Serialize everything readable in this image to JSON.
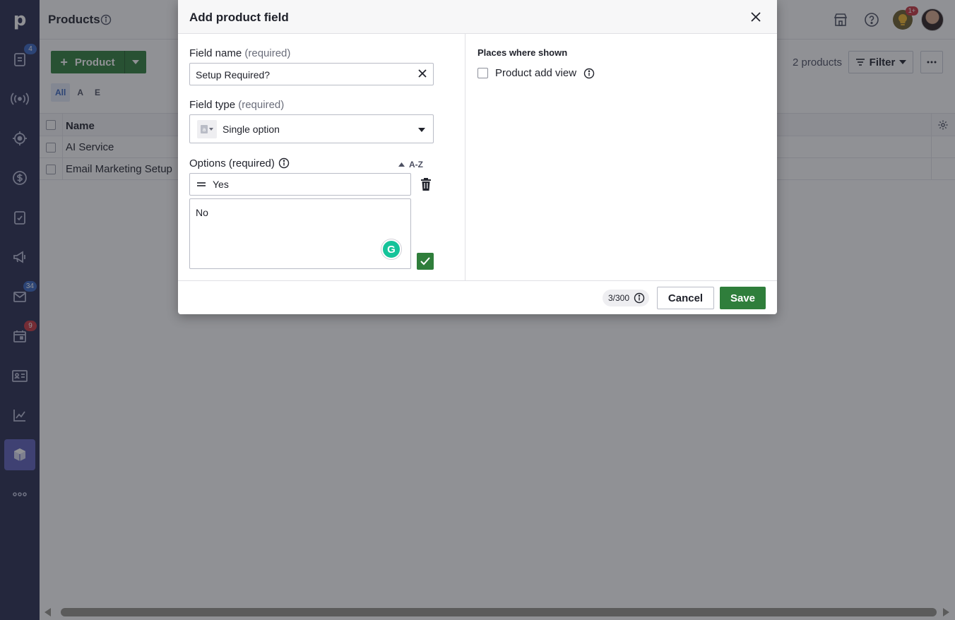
{
  "app": {
    "logo_letter": "p",
    "sidebar": [
      {
        "name": "leads",
        "icon": "clipboard-list-icon",
        "badge": "4",
        "badge_color": "#3764c1"
      },
      {
        "name": "deals",
        "icon": "broadcast-icon"
      },
      {
        "name": "projects",
        "icon": "target-icon"
      },
      {
        "name": "revenue",
        "icon": "dollar-icon"
      },
      {
        "name": "activities",
        "icon": "checklist-icon"
      },
      {
        "name": "campaigns",
        "icon": "megaphone-icon"
      },
      {
        "name": "mail",
        "icon": "envelope-icon",
        "badge": "34",
        "badge_color": "#3764c1"
      },
      {
        "name": "calendar",
        "icon": "calendar-icon",
        "badge": "9",
        "badge_color": "#c6353f"
      },
      {
        "name": "contacts",
        "icon": "contact-card-icon"
      },
      {
        "name": "insights",
        "icon": "chart-line-icon"
      },
      {
        "name": "products",
        "icon": "box-icon",
        "active": true
      },
      {
        "name": "more",
        "icon": "more-dots-icon"
      }
    ]
  },
  "page": {
    "title": "Products",
    "add_button": "Product",
    "filter_tabs": [
      "All",
      "A",
      "E"
    ],
    "count_text": "2 products",
    "filter_label": "Filter",
    "tip_badge": "1+",
    "table": {
      "header_name": "Name",
      "rows": [
        "AI Service",
        "Email Marketing Setup"
      ]
    }
  },
  "modal": {
    "title": "Add product field",
    "field_name_label": "Field name",
    "field_type_label": "Field type",
    "required_text": "(required)",
    "field_name_value": "Setup Required?",
    "field_type_value": "Single option",
    "options_label": "Options (required)",
    "sort_label": "A-Z",
    "options": [
      "Yes",
      "No"
    ],
    "places_title": "Places where shown",
    "places_option": "Product add view",
    "counter": "3/300",
    "cancel": "Cancel",
    "save": "Save",
    "grammarly_letter": "G"
  },
  "colors": {
    "sidebar_bg": "#262a4f",
    "primary_green": "#2f7e3b",
    "active_nav": "#5c5fbb"
  }
}
